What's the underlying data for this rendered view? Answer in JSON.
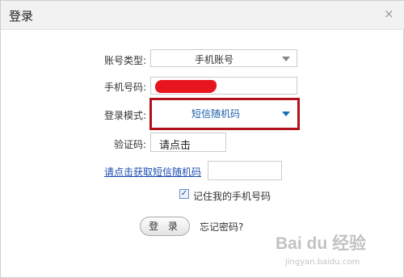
{
  "dialog": {
    "title": "登录",
    "close_glyph": "×"
  },
  "form": {
    "account_type": {
      "label": "账号类型:",
      "value": "手机账号"
    },
    "phone": {
      "label": "手机号码:",
      "value": ""
    },
    "login_mode": {
      "label": "登录模式:",
      "value": "短信随机码"
    },
    "captcha": {
      "label": "验证码:",
      "value": "请点击"
    },
    "sms_code": {
      "link": "请点击获取短信随机码",
      "value": ""
    },
    "remember": {
      "label": "记住我的手机号码",
      "checked": true,
      "glyph": "✓"
    },
    "login_button": "登 录",
    "forgot_link": "忘记密码?"
  },
  "watermark": {
    "brand": "Bai du 经验",
    "url": "jingyan.baidu.com"
  },
  "colors": {
    "highlight_border": "#b0111b",
    "redaction": "#e8141e",
    "link": "#1a4db3"
  }
}
